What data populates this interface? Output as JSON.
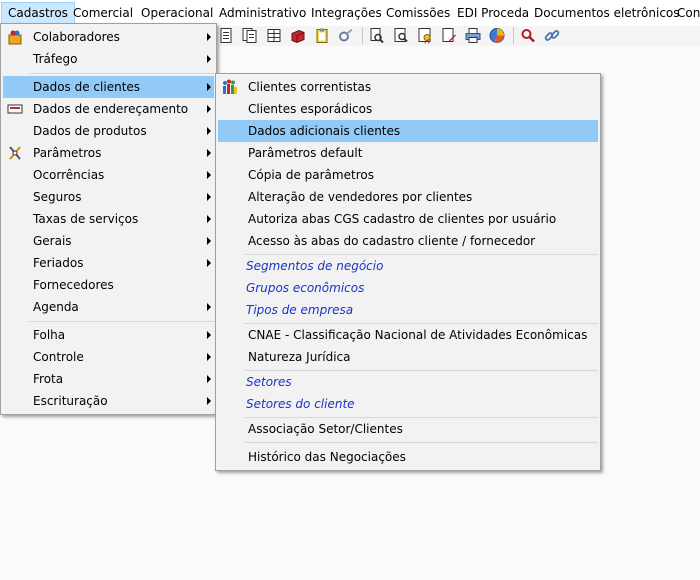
{
  "menubar": [
    {
      "label": "Cadastros",
      "active": true
    },
    {
      "label": "Comercial"
    },
    {
      "label": "Operacional"
    },
    {
      "label": "Administrativo"
    },
    {
      "label": "Integrações"
    },
    {
      "label": "Comissões"
    },
    {
      "label": "EDI Proceda"
    },
    {
      "label": "Documentos eletrônicos"
    },
    {
      "label": "Cont"
    }
  ],
  "cadastros_menu": [
    {
      "label": "Colaboradores",
      "submenu": true,
      "icon": "colaboradores-icon"
    },
    {
      "label": "Tráfego",
      "submenu": true
    },
    {
      "label": "Dados de clientes",
      "submenu": true,
      "highlighted": true
    },
    {
      "label": "Dados de endereçamento",
      "submenu": true,
      "icon": "endereco-icon"
    },
    {
      "label": "Dados de produtos",
      "submenu": true
    },
    {
      "label": "Parâmetros",
      "submenu": true,
      "icon": "parametros-icon"
    },
    {
      "label": "Ocorrências",
      "submenu": true
    },
    {
      "label": "Seguros",
      "submenu": true
    },
    {
      "label": "Taxas de serviços",
      "submenu": true
    },
    {
      "label": "Gerais",
      "submenu": true
    },
    {
      "label": "Feriados",
      "submenu": true
    },
    {
      "label": "Fornecedores",
      "submenu": false
    },
    {
      "label": "Agenda",
      "submenu": true
    },
    {
      "label": "Folha",
      "submenu": true
    },
    {
      "label": "Controle",
      "submenu": true
    },
    {
      "label": "Frota",
      "submenu": true
    },
    {
      "label": "Escrituração",
      "submenu": true
    }
  ],
  "clientes_submenu": [
    {
      "label": "Clientes correntistas",
      "icon": "clientes-correntistas-icon"
    },
    {
      "label": "Clientes esporádicos"
    },
    {
      "label": "Dados adicionais clientes",
      "highlighted": true
    },
    {
      "label": "Parâmetros default"
    },
    {
      "label": "Cópia de parâmetros"
    },
    {
      "label": "Alteração de vendedores por clientes"
    },
    {
      "label": "Autoriza abas CGS cadastro de clientes por usuário"
    },
    {
      "label": "Acesso às abas do cadastro cliente / fornecedor"
    },
    {
      "label": "Segmentos de negócio",
      "style": "link"
    },
    {
      "label": "Grupos econômicos",
      "style": "link"
    },
    {
      "label": "Tipos de empresa",
      "style": "link"
    },
    {
      "label": "CNAE - Classificação Nacional de Atividades Econômicas"
    },
    {
      "label": "Natureza Jurídica"
    },
    {
      "label": "Setores",
      "style": "link"
    },
    {
      "label": "Setores do cliente",
      "style": "link"
    },
    {
      "label": "Associação Setor/Clientes"
    },
    {
      "label": "Histórico das Negociações"
    }
  ],
  "toolbar_icons": [
    "document-icon",
    "documents-icon",
    "table-icon",
    "book-icon",
    "clipboard-icon",
    "tool-icon",
    "print-preview-icon",
    "document-search-icon",
    "certificate-icon",
    "document-edit-icon",
    "printer-icon",
    "pie-chart-icon",
    "search-icon",
    "link-icon"
  ],
  "colors": {
    "highlight": "#91c9f7",
    "menubar_active": "#cce8ff",
    "link": "#1a33c9"
  }
}
